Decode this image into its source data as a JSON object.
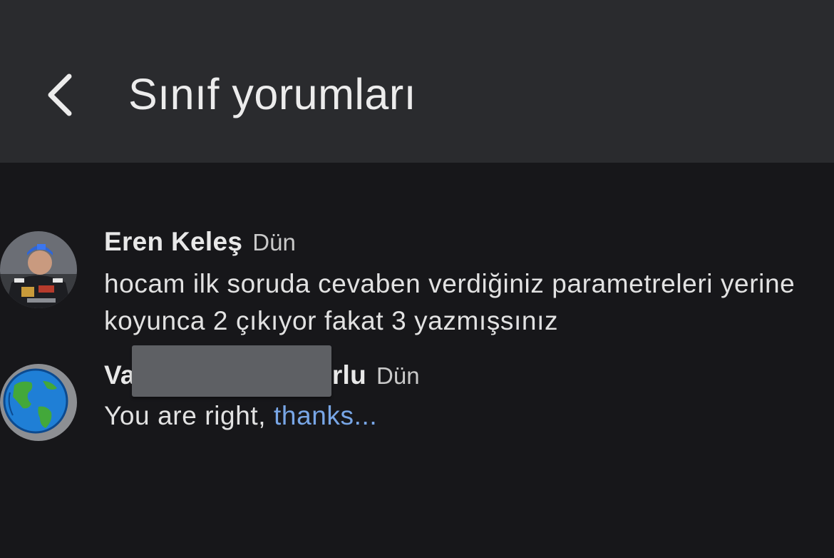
{
  "header": {
    "title": "Sınıf yorumları",
    "back_icon": "chevron-left-icon"
  },
  "comments": [
    {
      "author": "Eren Keleş",
      "time": "Dün",
      "text": "hocam ilk soruda cevaben verdiğiniz parametreleri yerine koyunca 2 çıkıyor fakat 3 yazmışsınız",
      "avatar": "user-photo-avatar"
    },
    {
      "author_start": "Va",
      "author_end": "rlu",
      "time": "Dün",
      "text": "You are right, ",
      "link_text": "thanks...",
      "avatar": "globe-avatar"
    }
  ],
  "colors": {
    "app_bar": "#2a2b2e",
    "background": "#17171a",
    "link": "#78a6e6",
    "redaction": "#5e6064"
  }
}
